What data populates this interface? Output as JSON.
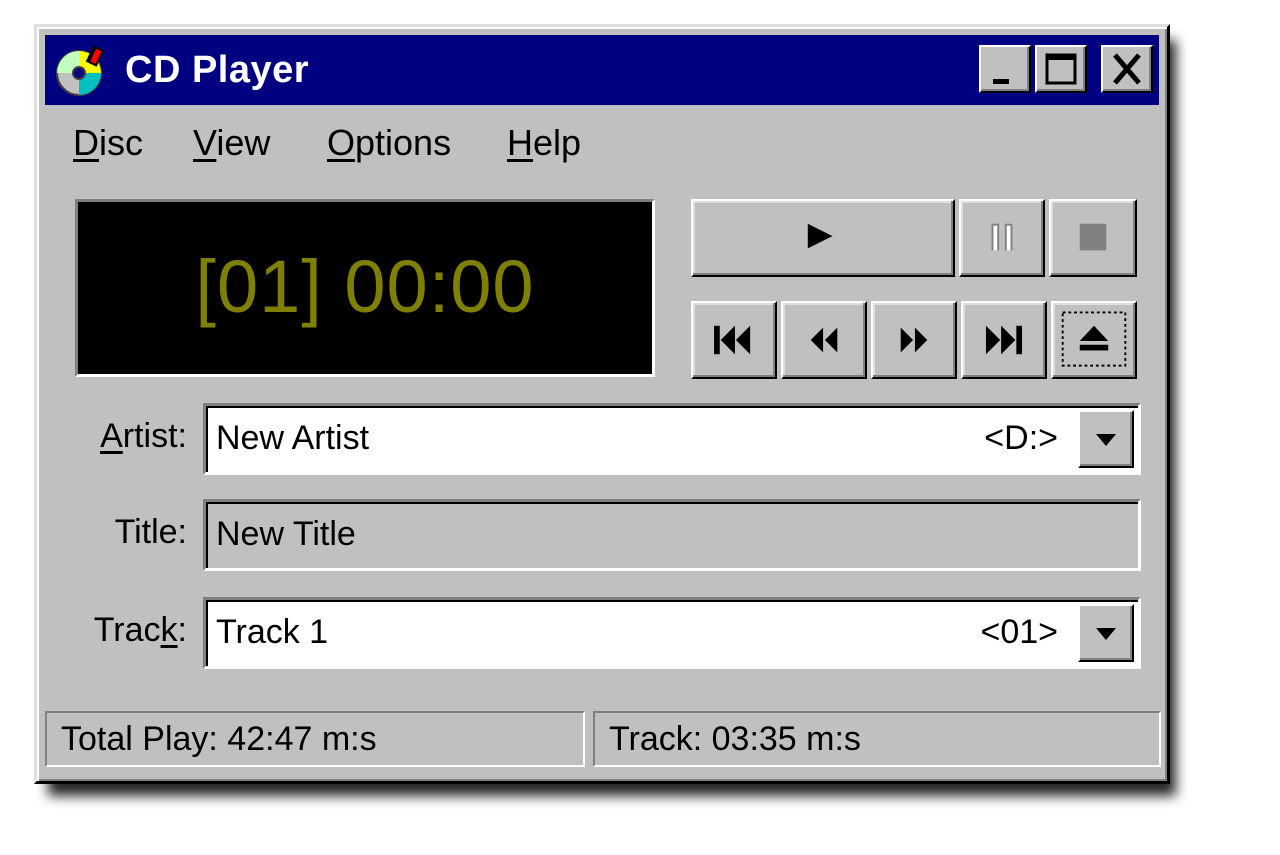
{
  "window": {
    "title": "CD Player",
    "icon": "cd-disc-icon"
  },
  "menu": {
    "items": [
      {
        "accel": "D",
        "rest": "isc"
      },
      {
        "accel": "V",
        "rest": "iew"
      },
      {
        "accel": "O",
        "rest": "ptions"
      },
      {
        "accel": "H",
        "rest": "elp"
      }
    ]
  },
  "display": {
    "text": "[01] 00:00",
    "color": "#808000"
  },
  "controls": {
    "play": "play-icon",
    "pause": "pause-icon",
    "stop": "stop-icon",
    "prev": "previous-track-icon",
    "rewind": "rewind-icon",
    "forward": "fast-forward-icon",
    "next": "next-track-icon",
    "eject": "eject-icon"
  },
  "fields": {
    "artist": {
      "label_accel": "A",
      "label_rest": "rtist:",
      "value": "New Artist",
      "tag": "<D:>"
    },
    "title": {
      "label": "Title:",
      "value": "New Title"
    },
    "track": {
      "label_pre": "Trac",
      "label_accel": "k",
      "label_post": ":",
      "value": "Track 1",
      "tag": "<01>"
    }
  },
  "status": {
    "total": "Total Play: 42:47 m:s",
    "track": "Track: 03:35 m:s"
  }
}
